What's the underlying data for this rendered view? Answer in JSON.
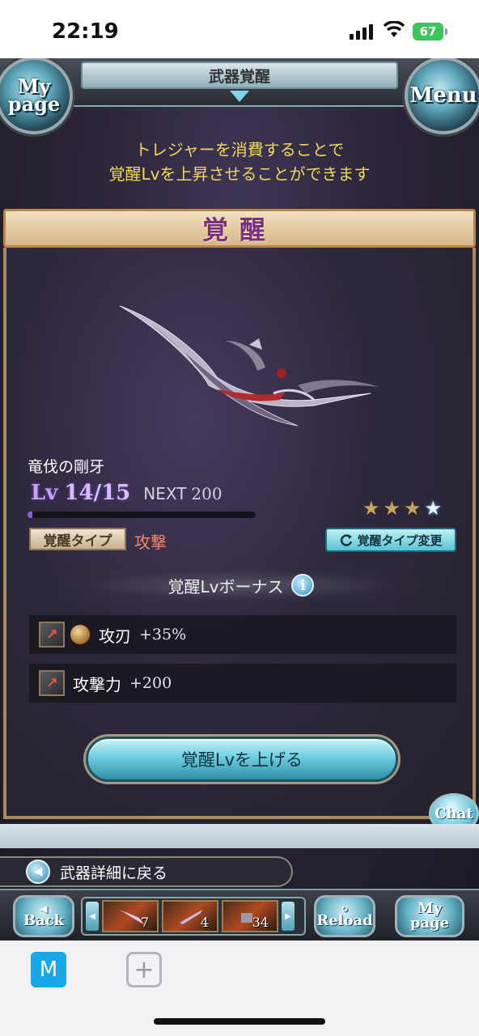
{
  "status_bar": {
    "time": "22:19",
    "battery": "67"
  },
  "header": {
    "title": "武器覚醒",
    "left_orb": "My page",
    "right_orb": "Menu"
  },
  "intro": "トレジャーを消費することで\n覚醒Lvを上昇させることができます",
  "panel": {
    "title": "覚醒",
    "weapon_name": "竜伐の剛牙",
    "level_label": "Lv",
    "level_value": "14/15",
    "next_label": "NEXT",
    "next_value": "200",
    "exp_progress": 0.02,
    "stars": [
      "★",
      "★",
      "★",
      "★"
    ],
    "type_tag": "覚醒タイプ",
    "type_value": "攻撃",
    "type_change_button": "覚醒タイプ変更",
    "type_change_icon": "refresh-icon",
    "bonus_title": "覚醒Lvボーナス",
    "info_icon_glyph": "i",
    "bonuses": [
      {
        "name": "攻刃",
        "value": "+35%",
        "icon": "attack-up-icon",
        "element_icon": "earth-element-icon"
      },
      {
        "name": "攻撃力",
        "value": "+200",
        "icon": "attack-up-icon"
      }
    ],
    "level_up_button": "覚醒Lvを上げる"
  },
  "chat_button": "Chat",
  "back_to_detail": "武器詳細に戻る",
  "footer": {
    "back": "Back",
    "thumb_counts": [
      "7",
      "4",
      "34"
    ],
    "reload": "Reload",
    "mypage": "My page"
  },
  "browser": {
    "m_label": "M",
    "plus_label": "+"
  },
  "colors": {
    "intro_text": "#f1d85c",
    "type_value": "#f08a62",
    "level": "#c6a2f5",
    "accent_button": "#6fcde0"
  }
}
